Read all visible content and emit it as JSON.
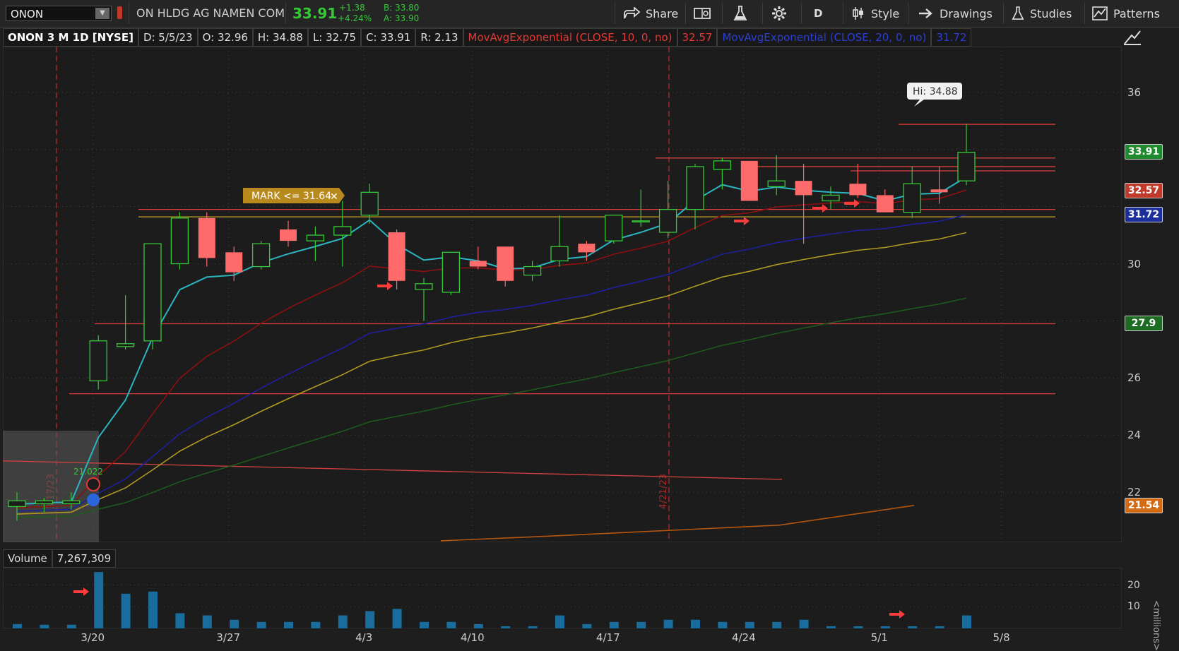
{
  "toolbar": {
    "symbol": "ONON",
    "description": "ON HLDG AG NAMEN COM",
    "last": "33.91",
    "change": "+1.38",
    "change_pct": "+4.24%",
    "bid": "B: 33.80",
    "ask": "A: 33.90",
    "share_label": "Share",
    "aggregation": "D",
    "style_label": "Style",
    "drawings_label": "Drawings",
    "studies_label": "Studies",
    "patterns_label": "Patterns"
  },
  "info": {
    "title": "ONON 3 M 1D [NYSE]",
    "date": "D: 5/5/23",
    "open": "O: 32.96",
    "high": "H: 34.88",
    "low": "L: 32.75",
    "close": "C: 33.91",
    "range": "R: 2.13",
    "ema10_label": "MovAvgExponential (CLOSE, 10, 0, no)",
    "ema10_value": "32.57",
    "ema20_label": "MovAvgExponential (CLOSE, 20, 0, no)",
    "ema20_value": "31.72"
  },
  "annotations": {
    "mark_alert": "MARK <= 31.64",
    "hi_bubble": "Hi: 34.88",
    "vline1": "3/17/23",
    "vline2": "4/21/23",
    "last_small": "21.022"
  },
  "price_axis": {
    "labels": [
      "36",
      "30",
      "26",
      "24",
      "22"
    ],
    "badges": [
      {
        "text": "33.91",
        "bg": "#1e8c2e",
        "fg": "#ffffff"
      },
      {
        "text": "32.57",
        "bg": "#c0392b",
        "fg": "#ffffff"
      },
      {
        "text": "31.72",
        "bg": "#1b2f9c",
        "fg": "#ffffff"
      },
      {
        "text": "27.9",
        "bg": "#1e6b24",
        "fg": "#ffffff"
      },
      {
        "text": "21.54",
        "bg": "#d66a10",
        "fg": "#ffffff"
      }
    ]
  },
  "volume": {
    "label": "Volume",
    "value": "7,267,309",
    "axis_labels": [
      "20",
      "10"
    ],
    "unit": "<millions>"
  },
  "date_axis": [
    "3/20",
    "3/27",
    "4/3",
    "4/10",
    "4/17",
    "4/24",
    "5/1",
    "5/8"
  ],
  "colors": {
    "bull": "#37c837",
    "bear": "#ff6b6b",
    "ema10": "#8b1010",
    "ema_cyan": "#2bb5c0",
    "ema20": "#1d1f9c",
    "ema_yellow": "#b09a22",
    "ema_green": "#1c5e1c",
    "ema_orange": "#b5560e",
    "hline": "#d93c3c",
    "volume": "#1a6c9c"
  },
  "chart_data": {
    "type": "candlestick",
    "y_range": [
      20.25,
      37.6
    ],
    "candles": [
      {
        "d": "3/15",
        "o": 21.5,
        "h": 22,
        "l": 21,
        "c": 21.7
      },
      {
        "d": "3/16",
        "o": 21.6,
        "h": 21.8,
        "l": 21.3,
        "c": 21.7
      },
      {
        "d": "3/17",
        "o": 21.6,
        "h": 22,
        "l": 21.4,
        "c": 21.7
      },
      {
        "d": "3/20",
        "o": 25.9,
        "h": 27.5,
        "l": 25.6,
        "c": 27.3
      },
      {
        "d": "3/21",
        "o": 27.1,
        "h": 28.9,
        "l": 27,
        "c": 27.2
      },
      {
        "d": "3/22",
        "o": 27.3,
        "h": 30.5,
        "l": 27,
        "c": 30.7
      },
      {
        "d": "3/23",
        "o": 30,
        "h": 31.8,
        "l": 29.8,
        "c": 31.6
      },
      {
        "d": "3/24",
        "o": 31.6,
        "h": 31.8,
        "l": 29.9,
        "c": 30.2
      },
      {
        "d": "3/27",
        "o": 30.4,
        "h": 30.6,
        "l": 29.4,
        "c": 29.7
      },
      {
        "d": "3/28",
        "o": 29.9,
        "h": 30.8,
        "l": 29.8,
        "c": 30.7
      },
      {
        "d": "3/29",
        "o": 31.2,
        "h": 31.5,
        "l": 30.6,
        "c": 30.8
      },
      {
        "d": "3/30",
        "o": 30.8,
        "h": 31.3,
        "l": 30.1,
        "c": 31
      },
      {
        "d": "3/31",
        "o": 31,
        "h": 32.2,
        "l": 29.9,
        "c": 31.3
      },
      {
        "d": "4/3",
        "o": 31.7,
        "h": 32.8,
        "l": 31.4,
        "c": 32.5
      },
      {
        "d": "4/4",
        "o": 31.1,
        "h": 31.2,
        "l": 29.1,
        "c": 29.4
      },
      {
        "d": "4/5",
        "o": 29.1,
        "h": 29.5,
        "l": 28,
        "c": 29.3
      },
      {
        "d": "4/6",
        "o": 29,
        "h": 30.4,
        "l": 28.9,
        "c": 30.4
      },
      {
        "d": "4/10",
        "o": 30.1,
        "h": 30.6,
        "l": 29.8,
        "c": 29.9
      },
      {
        "d": "4/11",
        "o": 30.6,
        "h": 30.6,
        "l": 29.2,
        "c": 29.4
      },
      {
        "d": "4/12",
        "o": 29.6,
        "h": 30.1,
        "l": 29.4,
        "c": 29.9
      },
      {
        "d": "4/13",
        "o": 30.1,
        "h": 31.7,
        "l": 29.9,
        "c": 30.6
      },
      {
        "d": "4/14",
        "o": 30.7,
        "h": 30.8,
        "l": 30.1,
        "c": 30.4
      },
      {
        "d": "4/17",
        "o": 30.8,
        "h": 31.6,
        "l": 30.7,
        "c": 31.7
      },
      {
        "d": "4/18",
        "o": 31.5,
        "h": 32.6,
        "l": 31.3,
        "c": 31.5
      },
      {
        "d": "4/19",
        "o": 31.1,
        "h": 32.9,
        "l": 30.9,
        "c": 31.9
      },
      {
        "d": "4/20",
        "o": 31.9,
        "h": 33.5,
        "l": 31.2,
        "c": 33.4
      },
      {
        "d": "4/21",
        "o": 33.3,
        "h": 33.7,
        "l": 32.6,
        "c": 33.6
      },
      {
        "d": "4/24",
        "o": 33.6,
        "h": 33.6,
        "l": 32.2,
        "c": 32.2
      },
      {
        "d": "4/25",
        "o": 32.7,
        "h": 33.8,
        "l": 32.4,
        "c": 32.9
      },
      {
        "d": "4/26",
        "o": 32.9,
        "h": 33.5,
        "l": 30.7,
        "c": 32.4
      },
      {
        "d": "4/27",
        "o": 32.2,
        "h": 32.7,
        "l": 31.9,
        "c": 32.4
      },
      {
        "d": "4/28",
        "o": 32.8,
        "h": 33.5,
        "l": 32.3,
        "c": 32.4
      },
      {
        "d": "5/1",
        "o": 32.4,
        "h": 32.6,
        "l": 31.8,
        "c": 31.8
      },
      {
        "d": "5/2",
        "o": 31.8,
        "h": 33.4,
        "l": 31.6,
        "c": 32.8
      },
      {
        "d": "5/3",
        "o": 32.6,
        "h": 33.4,
        "l": 32.1,
        "c": 32.5
      },
      {
        "d": "5/4",
        "o": 32.9,
        "h": 34.9,
        "l": 32.75,
        "c": 33.9
      }
    ],
    "volume_millions": [
      2,
      1.7,
      1.7,
      26,
      16,
      17,
      7,
      6,
      4,
      3,
      3,
      3,
      6,
      8,
      9,
      3,
      3,
      2,
      1,
      1,
      6,
      2,
      3,
      3,
      4,
      4,
      3,
      3,
      3,
      4,
      1,
      1,
      1,
      1,
      1,
      6
    ]
  }
}
